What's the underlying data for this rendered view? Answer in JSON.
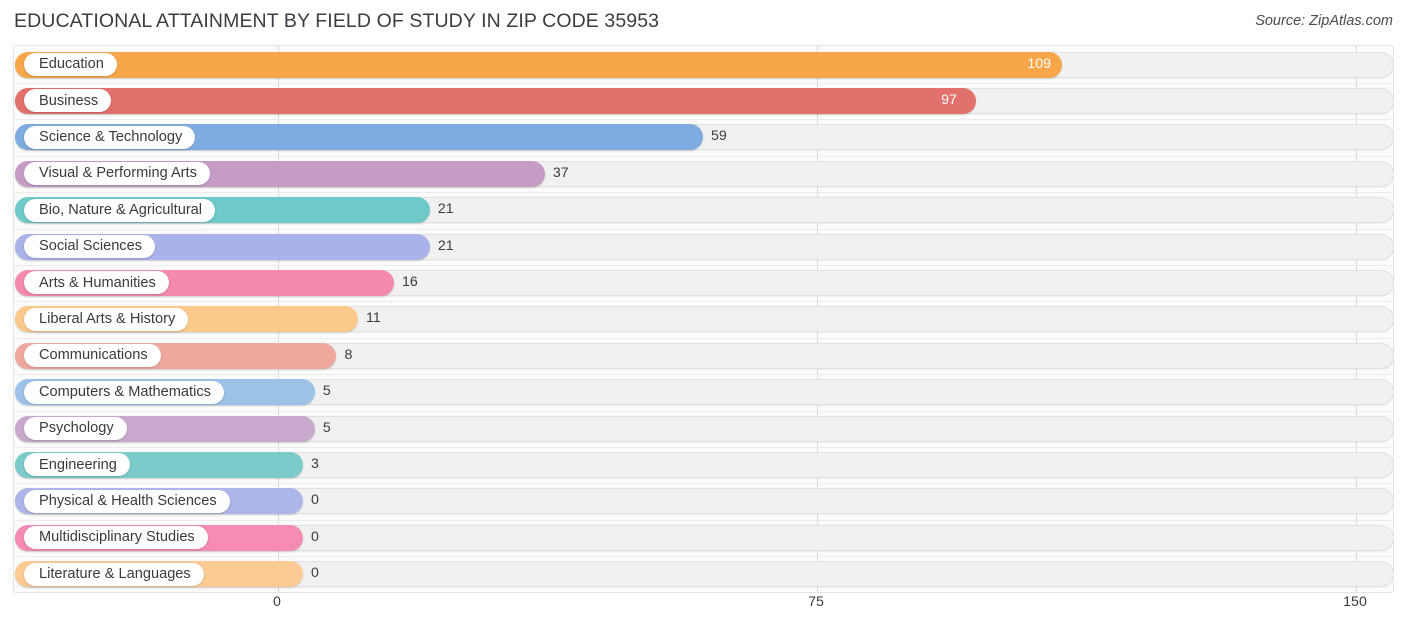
{
  "header": {
    "title": "EDUCATIONAL ATTAINMENT BY FIELD OF STUDY IN ZIP CODE 35953",
    "source": "Source: ZipAtlas.com"
  },
  "chart_data": {
    "type": "bar",
    "orientation": "horizontal",
    "title": "EDUCATIONAL ATTAINMENT BY FIELD OF STUDY IN ZIP CODE 35953",
    "xlabel": "",
    "ylabel": "",
    "xlim": [
      0,
      150
    ],
    "xticks": [
      0,
      75,
      150
    ],
    "xticklabels": [
      "0",
      "75",
      "150"
    ],
    "grid": true,
    "legend": false,
    "categories": [
      "Education",
      "Business",
      "Science & Technology",
      "Visual & Performing Arts",
      "Bio, Nature & Agricultural",
      "Social Sciences",
      "Arts & Humanities",
      "Liberal Arts & History",
      "Communications",
      "Computers & Mathematics",
      "Psychology",
      "Engineering",
      "Physical & Health Sciences",
      "Multidisciplinary Studies",
      "Literature & Languages"
    ],
    "values": [
      109,
      97,
      59,
      37,
      21,
      21,
      16,
      11,
      8,
      5,
      5,
      3,
      0,
      0,
      0
    ],
    "value_labels": [
      "109",
      "97",
      "59",
      "37",
      "21",
      "21",
      "16",
      "11",
      "8",
      "5",
      "5",
      "3",
      "0",
      "0",
      "0"
    ],
    "colors": [
      "#f7a74a",
      "#e2706b",
      "#7eabe0",
      "#c49cc6",
      "#6ec9c9",
      "#a9b3ea",
      "#f489ae",
      "#fbc98a",
      "#eea89d",
      "#9cc2e8",
      "#c9a9cd",
      "#7bcbcb",
      "#aeb5e8",
      "#f68cb3",
      "#fcca92"
    ]
  }
}
